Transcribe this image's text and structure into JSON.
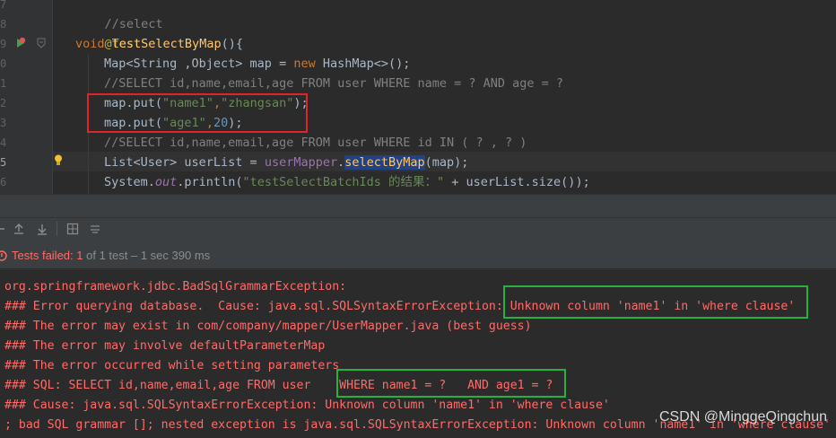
{
  "editor": {
    "line_numbers": [
      "7",
      "8",
      "9",
      "0",
      "1",
      "2",
      "3",
      "4",
      "5",
      "6"
    ],
    "comment_select": "//select",
    "annotation": "@Test",
    "kw_void": "void",
    "method_name": "testSelectByMap",
    "method_tail": "(){",
    "l10_type": "Map<String ,Object> map = ",
    "l10_new": "new",
    "l10_tail": " HashMap<>();",
    "l11_comment": "//SELECT id,name,email,age FROM user WHERE name = ? AND age = ?",
    "l12_a": "map.put(",
    "l12_s1": "\"name1\"",
    "l12_comma": ",",
    "l12_s2": "\"zhangsan\"",
    "l12_end": ");",
    "l13_a": "map.put(",
    "l13_s1": "\"age1\"",
    "l13_comma": ",",
    "l13_num": "20",
    "l13_end": ");",
    "l14_comment": "//SELECT id,name,email,age FROM user WHERE id IN ( ? , ? )",
    "l15_a": "List<User> userList = ",
    "l15_field": "userMapper",
    "l15_dot": ".",
    "l15_method": "selectByMap",
    "l15_end": "(map);",
    "l16_a": "System.",
    "l16_out": "out",
    "l16_b": ".println(",
    "l16_str": "\"testSelectBatchIds 的结果：\"",
    "l16_end": " + userList.size());"
  },
  "status": {
    "label": "Tests failed:",
    "count": "1",
    "detail": "of 1 test – 1 sec 390 ms"
  },
  "console": {
    "lines": [
      "org.springframework.jdbc.BadSqlGrammarException:",
      "### Error querying database.  Cause: java.sql.SQLSyntaxErrorException: Unknown column 'name1' in 'where clause'",
      "### The error may exist in com/company/mapper/UserMapper.java (best guess)",
      "### The error may involve defaultParameterMap",
      "### The error occurred while setting parameters",
      "### SQL: SELECT id,name,email,age FROM user    WHERE name1 = ?   AND age1 = ?",
      "### Cause: java.sql.SQLSyntaxErrorException: Unknown column 'name1' in 'where clause'",
      "; bad SQL grammar []; nested exception is java.sql.SQLSyntaxErrorException: Unknown column 'name1' in 'where clause'"
    ]
  },
  "watermark": "CSDN @MinggeQingchun",
  "colors": {
    "error": "#ff6b68",
    "red_box": "#e0252a",
    "green_box": "#28b040"
  }
}
